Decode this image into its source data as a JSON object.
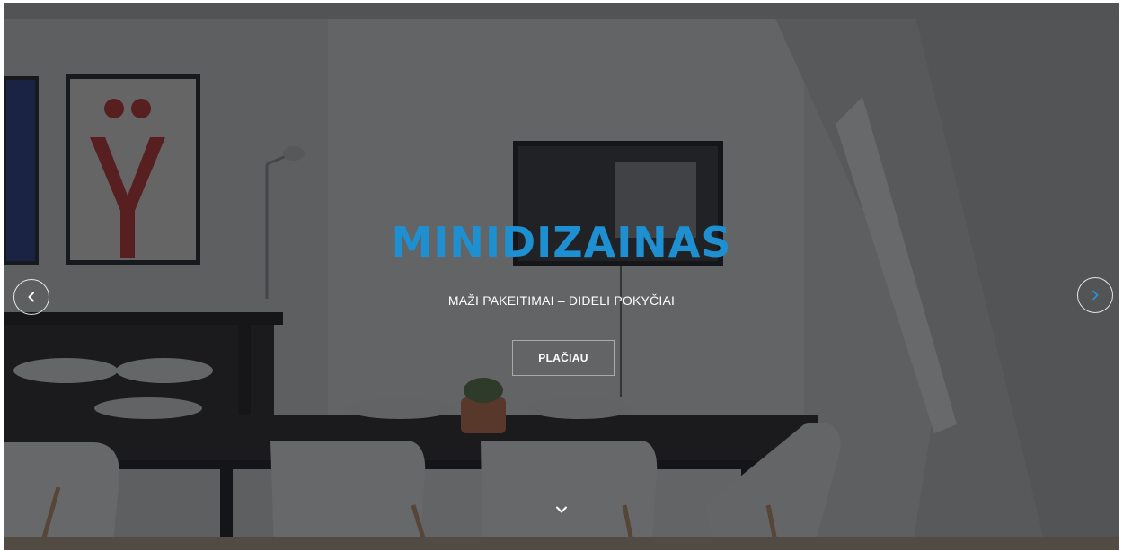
{
  "hero": {
    "title": "MINIDIZAINAS",
    "subtitle": "MAŽI PAKEITIMAI – DIDELI POKYČIAI",
    "cta_label": "PLAČIAU"
  },
  "carousel": {
    "prev_icon": "chevron-left-icon",
    "next_icon": "chevron-right-icon",
    "scroll_icon": "chevron-down-icon"
  },
  "colors": {
    "title": "#1e8fd0",
    "subtitle": "#ffffff",
    "next_arrow": "#2d8fd6",
    "prev_arrow": "#ffffff",
    "overlay": "#121418"
  }
}
